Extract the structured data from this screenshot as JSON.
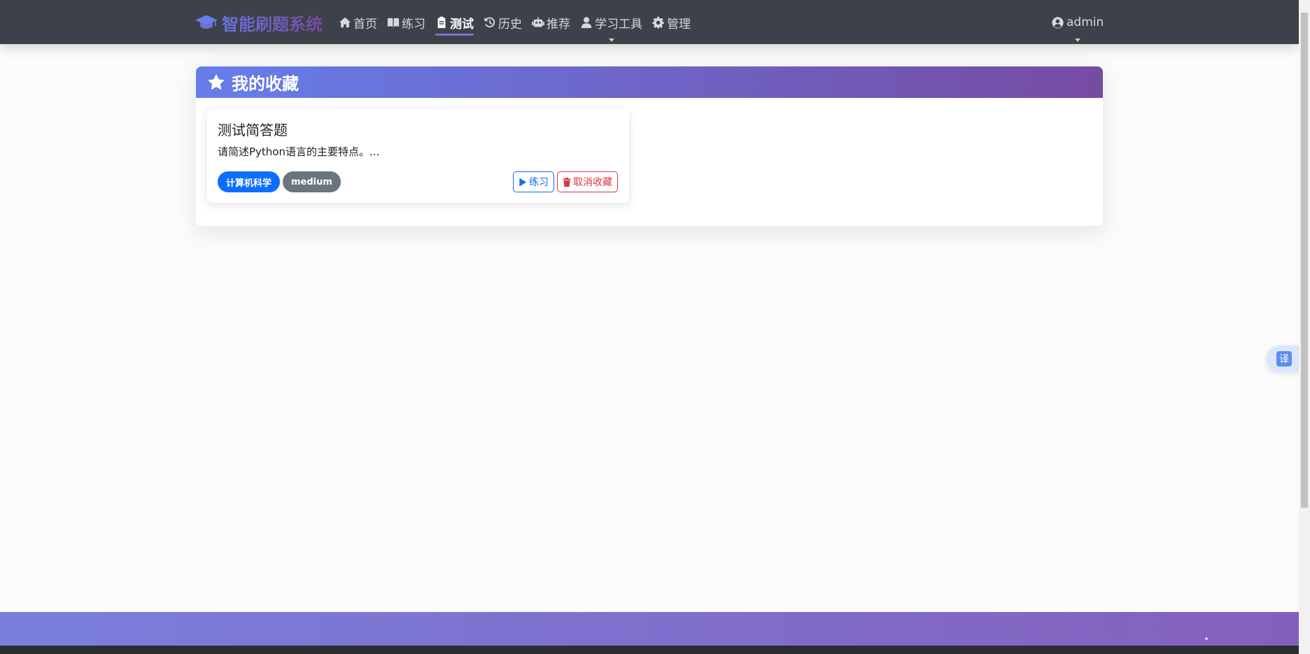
{
  "navbar": {
    "brand": "智能刷题系统",
    "items": [
      {
        "label": "首页",
        "icon": "home-icon",
        "active": false
      },
      {
        "label": "练习",
        "icon": "book-icon",
        "active": false
      },
      {
        "label": "测试",
        "icon": "clipboard-icon",
        "active": true
      },
      {
        "label": "历史",
        "icon": "history-icon",
        "active": false
      },
      {
        "label": "推荐",
        "icon": "robot-icon",
        "active": false
      },
      {
        "label": "学习工具",
        "icon": "user-icon",
        "active": false,
        "dropdown": true
      },
      {
        "label": "管理",
        "icon": "gear-icon",
        "active": false
      }
    ],
    "user": "admin"
  },
  "panel": {
    "title": "我的收藏",
    "icon": "star-icon"
  },
  "favorites": [
    {
      "title": "测试简答题",
      "excerpt": "请简述Python语言的主要特点。...",
      "tags": [
        "计算机科学",
        "medium"
      ],
      "practice_label": "练习",
      "remove_label": "取消收藏"
    }
  ],
  "translate_label": "译",
  "colors": {
    "gradient_start": "#667eea",
    "gradient_end": "#764ba2",
    "navbar": "#3d4149",
    "primary": "#0d6efd",
    "danger": "#dc3545",
    "secondary": "#6c757d"
  }
}
